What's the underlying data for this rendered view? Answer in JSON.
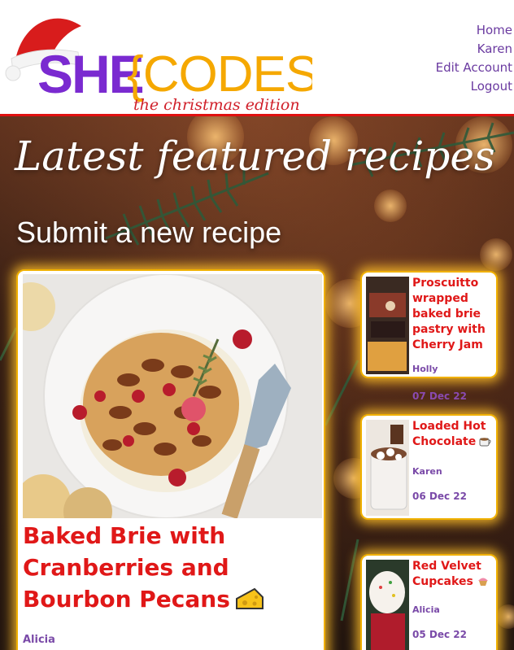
{
  "site": {
    "logo_text": "SHE{CODES}",
    "logo_subtitle": "the christmas edition"
  },
  "nav": {
    "home": "Home",
    "user": "Karen",
    "edit_account": "Edit Account",
    "logout": "Logout"
  },
  "page": {
    "heading": "Latest featured recipes",
    "submit_link": "Submit a new recipe"
  },
  "featured": {
    "title": "Baked Brie with Cranberries and Bourbon Pecans",
    "title_emoji": "cheese-icon",
    "author": "Alicia"
  },
  "side_recipes": [
    {
      "title": "Proscuitto wrapped baked brie pastry with Cherry Jam",
      "author": "Holly",
      "date": "07 Dec 22"
    },
    {
      "title": "Loaded Hot Chocolate",
      "emoji": "hot-beverage-icon",
      "author": "Karen",
      "date": "06 Dec 22"
    },
    {
      "title": "Red Velvet Cupcakes",
      "emoji": "cupcake-icon",
      "author": "Alicia",
      "date": "05 Dec 22"
    }
  ],
  "colors": {
    "accent_red": "#e01818",
    "accent_purple": "#6a3aa0",
    "logo_yellow": "#f5a800",
    "card_glow": "#f0b000"
  }
}
